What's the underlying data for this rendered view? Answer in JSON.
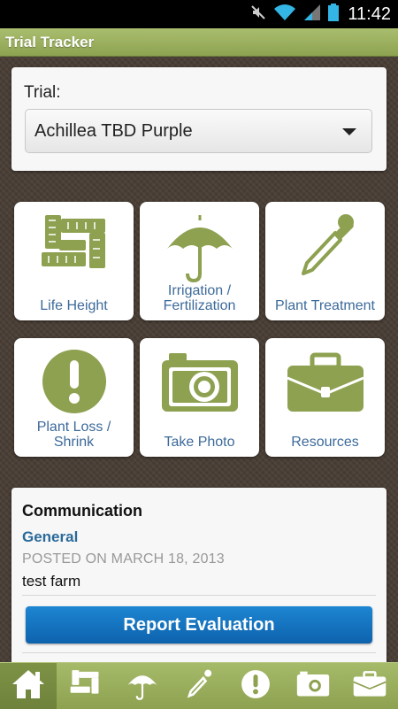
{
  "status_bar": {
    "time": "11:42"
  },
  "app": {
    "title": "Trial Tracker"
  },
  "trial": {
    "label": "Trial:",
    "selected": "Achillea TBD Purple"
  },
  "tiles": [
    {
      "label": "Life Height",
      "icon": "ruler-icon"
    },
    {
      "label": "Irrigation / Fertilization",
      "icon": "umbrella-icon"
    },
    {
      "label": "Plant Treatment",
      "icon": "dropper-icon"
    },
    {
      "label": "Plant Loss / Shrink",
      "icon": "alert-icon"
    },
    {
      "label": "Take Photo",
      "icon": "camera-icon"
    },
    {
      "label": "Resources",
      "icon": "briefcase-icon"
    }
  ],
  "communication": {
    "title": "Communication",
    "subtitle": "General",
    "posted": "POSTED ON MARCH 18, 2013",
    "body": "test farm",
    "button": "Report Evaluation"
  },
  "tabs": [
    "home-icon",
    "ruler-icon",
    "umbrella-icon",
    "dropper-icon",
    "alert-icon",
    "camera-icon",
    "briefcase-icon"
  ],
  "colors": {
    "accent_green": "#8da150",
    "icon_green": "#8da150",
    "label_blue": "#3c6a9a",
    "button_blue": "#1476c4"
  }
}
